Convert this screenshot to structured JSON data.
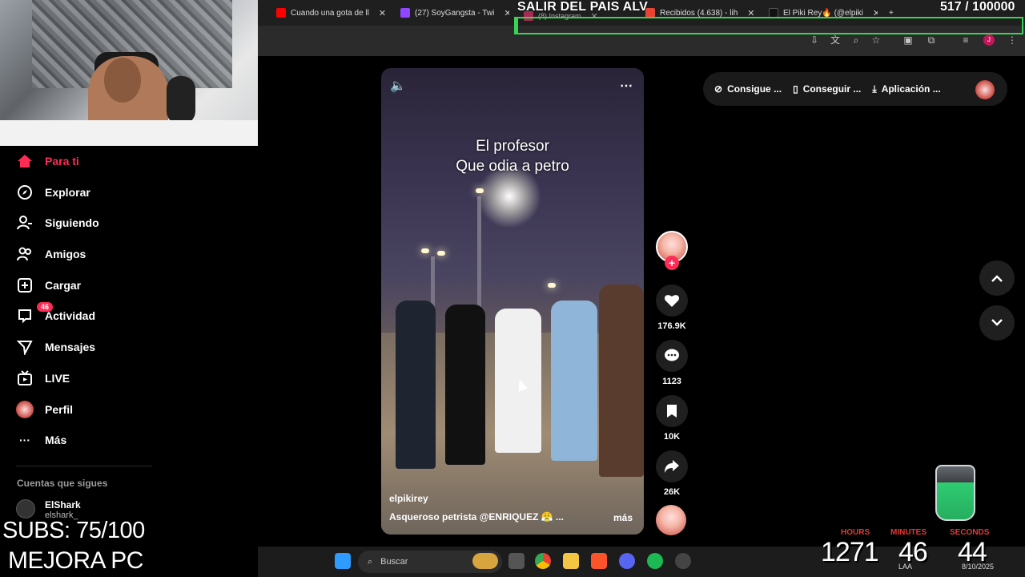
{
  "browser": {
    "tabs": [
      {
        "label": "Cuando una gota de ll",
        "color": "#ff0000"
      },
      {
        "label": "(27) SoyGangsta - Twi",
        "color": "#9146ff"
      },
      {
        "label": "(8) Instagram",
        "color": "#e1306c"
      },
      {
        "label": "Recibidos (4.638) - lih",
        "color": "#ea4335"
      },
      {
        "label": "El Piki Rey🔥 (@elpiki",
        "color": "#111111"
      }
    ],
    "new_tab": "+"
  },
  "overlay": {
    "goal_title": "SALIR DEL PAIS ALV",
    "goal_current": "517",
    "goal_target": "/ 100000",
    "goal_fraction": 0.00517
  },
  "sidebar": {
    "items": [
      {
        "label": "Para ti",
        "icon": "home-icon"
      },
      {
        "label": "Explorar",
        "icon": "compass-icon"
      },
      {
        "label": "Siguiendo",
        "icon": "user-follow-icon"
      },
      {
        "label": "Amigos",
        "icon": "friends-icon"
      },
      {
        "label": "Cargar",
        "icon": "upload-icon"
      },
      {
        "label": "Actividad",
        "icon": "activity-icon",
        "badge": "46"
      },
      {
        "label": "Mensajes",
        "icon": "send-icon"
      },
      {
        "label": "LIVE",
        "icon": "live-icon"
      },
      {
        "label": "Perfil",
        "icon": "avatar"
      },
      {
        "label": "Más",
        "icon": "more-icon"
      }
    ],
    "following_header": "Cuentas que sigues",
    "following": [
      {
        "name": "ElShark",
        "handle": "elshark_"
      }
    ]
  },
  "stream_overlay": {
    "subs": "SUBS: 75/100",
    "mejora": "MEJORA PC"
  },
  "video": {
    "caption_line1": "El profesor",
    "caption_line2": "Que odia a petro",
    "author": "elpikirey",
    "description": "Asqueroso petrista @ENRIQUEZ 😤 ...",
    "more": "más"
  },
  "actions": {
    "likes": "176.9K",
    "comments": "1123",
    "saves": "10K",
    "shares": "26K"
  },
  "top_pill": {
    "item1": "Consigue ...",
    "item2": "Conseguir ...",
    "item3": "Aplicación ..."
  },
  "taskbar": {
    "search_placeholder": "Buscar",
    "time": "",
    "date": "8/10/2025",
    "lang": "LAA"
  },
  "timer": {
    "hours_label": "HOURS",
    "minutes_label": "MINUTES",
    "seconds_label": "SECONDS",
    "hours": "1271",
    "minutes": "46",
    "seconds": "44"
  },
  "colors": {
    "accent": "#fe2c55",
    "goal_green": "#39d353",
    "timer_label_red": "#e53935"
  }
}
